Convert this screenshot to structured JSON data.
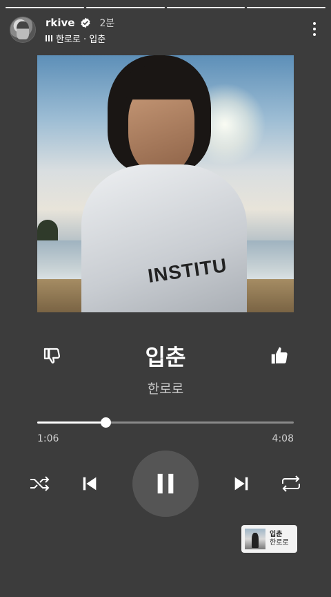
{
  "story": {
    "segments": 4,
    "active_segment": 4,
    "username": "rkive",
    "verified": true,
    "time_ago": "2분",
    "music_label": "한로로 · 입춘"
  },
  "player": {
    "title": "입춘",
    "artist": "한로로",
    "current_time": "1:06",
    "total_time": "4:08",
    "progress_fraction": 0.266,
    "state": "playing"
  },
  "sticker": {
    "title": "입춘",
    "artist": "한로로"
  },
  "album_art": {
    "shirt_text": "INSTITU"
  },
  "icons": {
    "more": "more-vertical-icon",
    "dislike": "thumbs-down-icon",
    "like": "thumbs-up-icon",
    "shuffle": "shuffle-icon",
    "previous": "skip-previous-icon",
    "pause": "pause-icon",
    "next": "skip-next-icon",
    "repeat": "repeat-icon"
  },
  "colors": {
    "background": "#3c3c3c",
    "play_button": "#555555",
    "track": "#8a8a8a",
    "accent": "#ffffff"
  }
}
